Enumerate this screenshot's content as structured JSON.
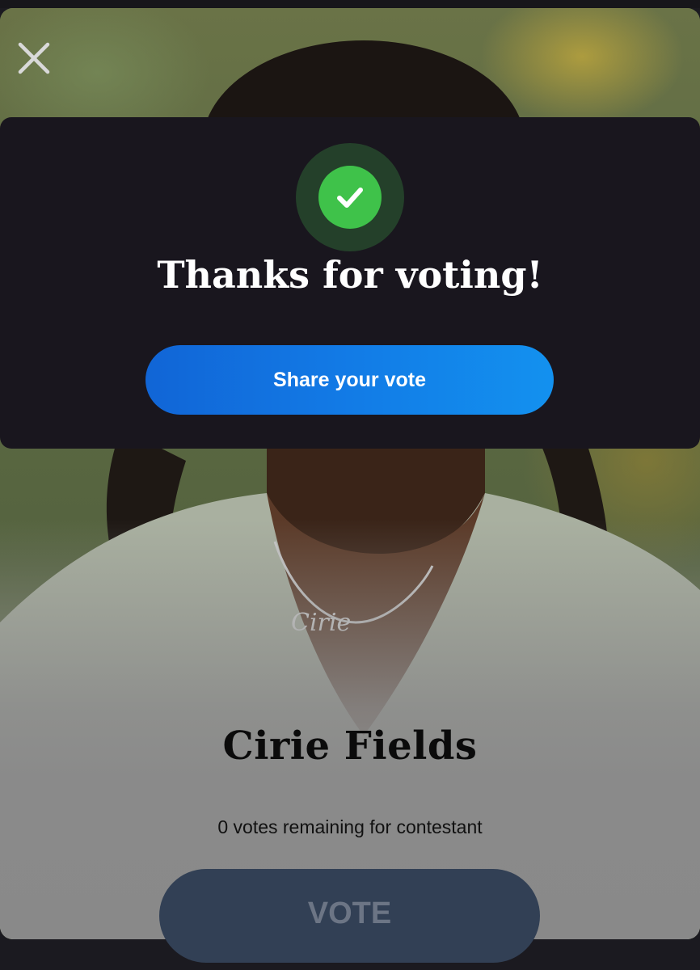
{
  "app": {
    "close_icon": "close-icon"
  },
  "modal": {
    "icon": "check-circle-icon",
    "title": "Thanks for voting!",
    "share_label": "Share your vote",
    "colors": {
      "accent_green": "#3fc24a",
      "button_blue": "#127be6"
    }
  },
  "contestant": {
    "name": "Cirie Fields",
    "votes_remaining_text": "0 votes remaining for contestant",
    "vote_label": "VOTE",
    "vote_enabled": false
  }
}
